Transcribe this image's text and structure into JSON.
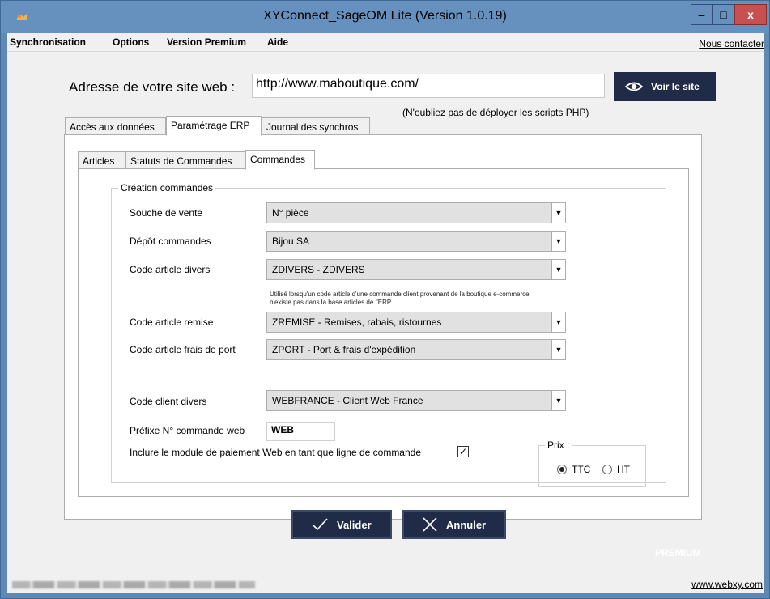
{
  "window": {
    "title": "XYConnect_SageOM Lite (Version 1.0.19)",
    "app_icon": "xyconnect-app-icon",
    "controls": {
      "minimize": "minimize-icon",
      "maximize": "maximize-icon",
      "close": "close-icon",
      "close_glyph": "x"
    }
  },
  "menu": {
    "items": [
      "Synchronisation",
      "Options",
      "Version Premium",
      "Aide"
    ],
    "contact": "Nous contacter"
  },
  "site": {
    "label": "Adresse de votre site web :",
    "url": "http://www.maboutique.com/",
    "view_button": "Voir le site",
    "view_icon": "eye-icon",
    "note": "(N'oubliez pas de déployer les scripts PHP)"
  },
  "tabs": [
    {
      "label": "Accès aux données",
      "active": false
    },
    {
      "label": "Paramétrage ERP",
      "active": true
    },
    {
      "label": "Journal des synchros",
      "active": false
    }
  ],
  "subtabs": [
    {
      "label": "Articles",
      "active": false
    },
    {
      "label": "Statuts de Commandes",
      "active": false
    },
    {
      "label": "Commandes",
      "active": true
    }
  ],
  "group": {
    "title": "Création commandes",
    "fields": {
      "souche": {
        "label": "Souche de vente",
        "value": "N° pièce"
      },
      "depot": {
        "label": "Dépôt commandes",
        "value": "Bijou SA"
      },
      "code_divers": {
        "label": "Code article divers",
        "value": "ZDIVERS - ZDIVERS"
      },
      "help": "Utilisé lorsqu'un code article d'une commande client provenant de la boutique e-commerce n'existe pas dans la base articles de l'ERP",
      "code_remise": {
        "label": "Code article remise",
        "value": "ZREMISE - Remises, rabais, ristournes"
      },
      "code_port": {
        "label": "Code article frais de port",
        "value": "ZPORT - Port & frais d'expédition"
      },
      "client_divers": {
        "label": "Code client divers",
        "value": "WEBFRANCE - Client Web France"
      },
      "prefixe": {
        "label": "Préfixe N° commande web",
        "value": "WEB"
      },
      "paiement": {
        "label": "Inclure le module de paiement Web en tant que ligne de commande",
        "checked": true
      }
    },
    "prix": {
      "title": "Prix :",
      "options": [
        {
          "label": "TTC",
          "selected": true
        },
        {
          "label": "HT",
          "selected": false
        }
      ]
    }
  },
  "actions": {
    "validate": "Valider",
    "validate_icon": "checkmark-icon",
    "cancel": "Annuler",
    "cancel_icon": "x-icon"
  },
  "brand_fragment": "PREMIUM",
  "status": {
    "link": "www.webxy.com"
  },
  "colors": {
    "title_bar": "#6690bd",
    "dark_button": "#1f2b47",
    "close_button": "#c75050"
  }
}
